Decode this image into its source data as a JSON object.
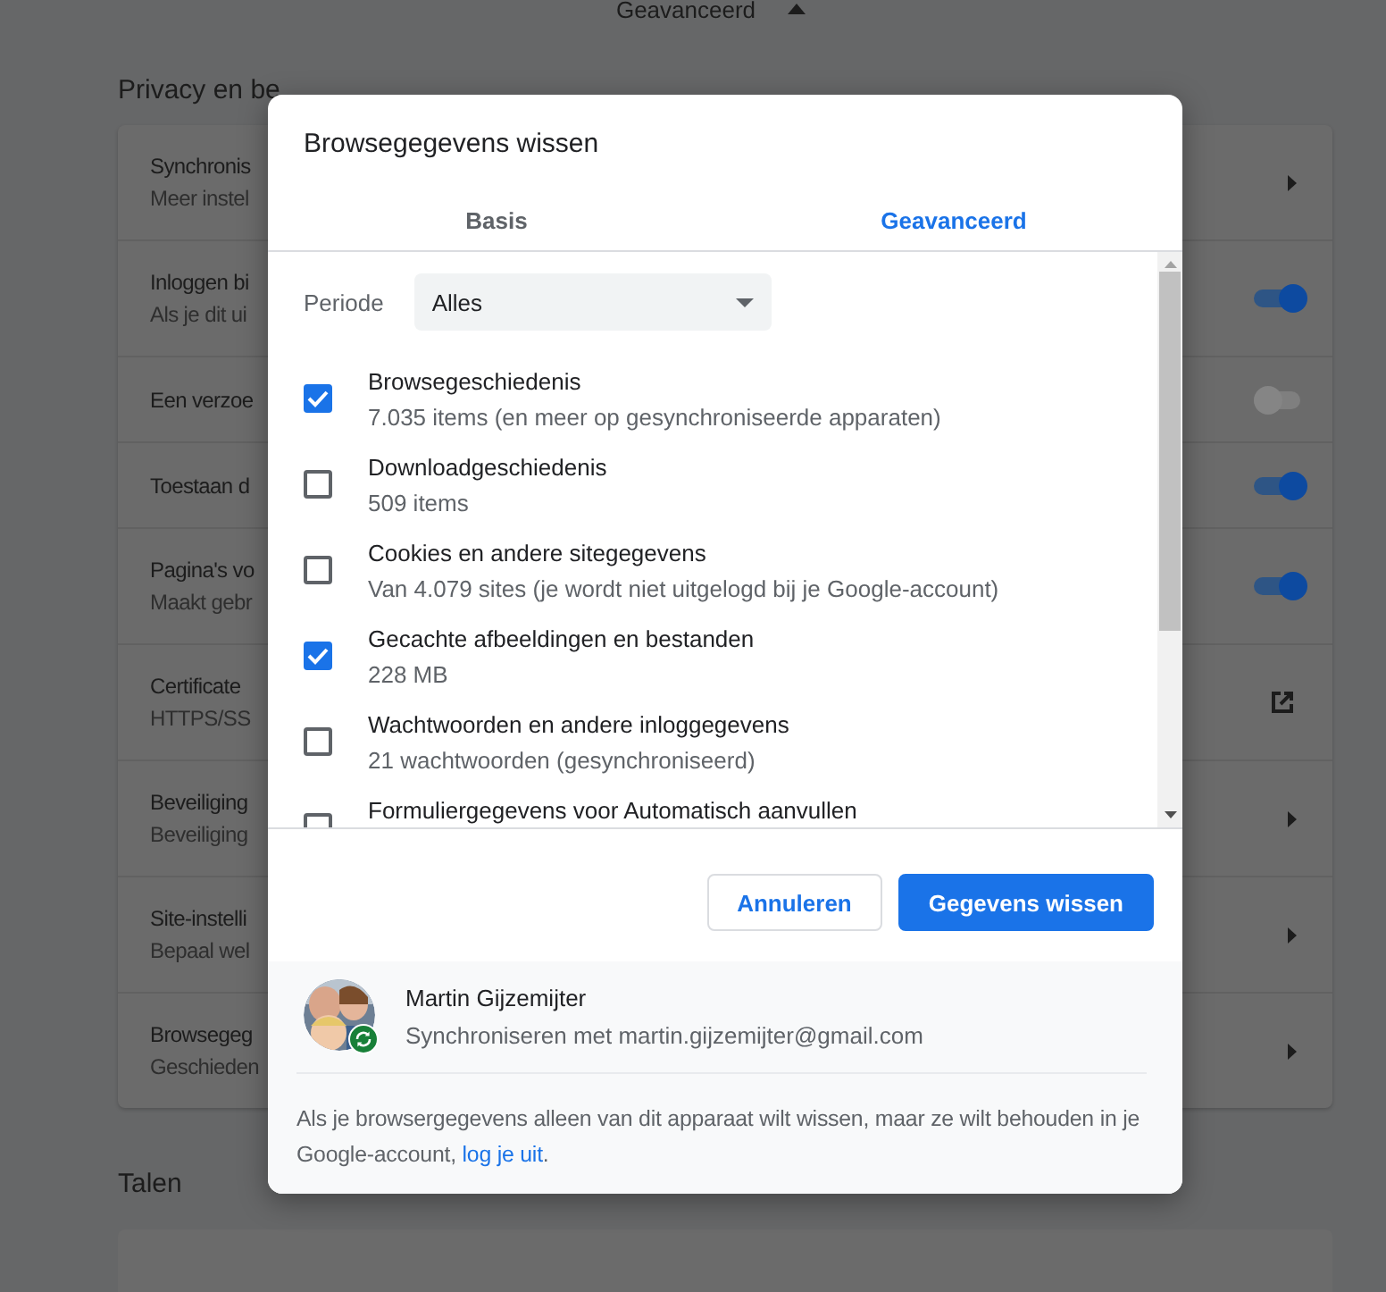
{
  "settings_page": {
    "header_link": "Geavanceerd",
    "section_title": "Privacy en be",
    "rows": [
      {
        "title": "Synchronis",
        "subtitle": "Meer instel",
        "kind": "arrow"
      },
      {
        "title": "Inloggen bi",
        "subtitle": "Als je dit ui",
        "kind": "toggle",
        "on": true
      },
      {
        "title": "Een verzoe",
        "kind": "toggle",
        "on": false
      },
      {
        "title": "Toestaan d",
        "kind": "toggle",
        "on": true
      },
      {
        "title": "Pagina's vo",
        "subtitle": "Maakt gebr",
        "kind": "toggle",
        "on": true
      },
      {
        "title": "Certificate",
        "subtitle": "HTTPS/SS",
        "kind": "external"
      },
      {
        "title": "Beveiliging",
        "subtitle": "Beveiliging",
        "kind": "arrow"
      },
      {
        "title": "Site-instelli",
        "subtitle": "Bepaal wel",
        "kind": "arrow"
      },
      {
        "title": "Browsegeg",
        "subtitle": "Geschieden",
        "kind": "arrow"
      }
    ],
    "next_section_title": "Talen"
  },
  "dialog": {
    "title": "Browsegegevens wissen",
    "tabs": [
      {
        "label": "Basis",
        "selected": false
      },
      {
        "label": "Geavanceerd",
        "selected": true
      }
    ],
    "period": {
      "label": "Periode",
      "value": "Alles"
    },
    "items": [
      {
        "title": "Browsegeschiedenis",
        "subtitle": "7.035 items (en meer op gesynchroniseerde apparaten)",
        "checked": true
      },
      {
        "title": "Downloadgeschiedenis",
        "subtitle": "509 items",
        "checked": false
      },
      {
        "title": "Cookies en andere sitegegevens",
        "subtitle": "Van 4.079 sites (je wordt niet uitgelogd bij je Google-account)",
        "checked": false
      },
      {
        "title": "Gecachte afbeeldingen en bestanden",
        "subtitle": "228 MB",
        "checked": true
      },
      {
        "title": "Wachtwoorden en andere inloggegevens",
        "subtitle": "21 wachtwoorden (gesynchroniseerd)",
        "checked": false
      },
      {
        "title": "Formuliergegevens voor Automatisch aanvullen",
        "checked": false
      }
    ],
    "buttons": [
      {
        "label": "Annuleren",
        "kind": "secondary"
      },
      {
        "label": "Gegevens wissen",
        "kind": "primary"
      }
    ],
    "account": {
      "name": "Martin Gijzemijter",
      "email": "Synchroniseren met martin.gijzemijter@gmail.com"
    },
    "note": {
      "text": "Als je browsergegevens alleen van dit apparaat wilt wissen, maar ze wilt behouden in je Google-account,",
      "link": "log je uit",
      "end": "."
    }
  }
}
